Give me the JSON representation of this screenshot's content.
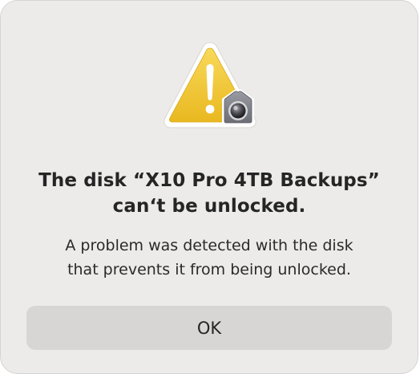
{
  "dialog": {
    "icon": "warning-icon",
    "badge_icon": "lock-icon",
    "title_lines": [
      "The disk “X10 Pro 4TB Backups”",
      "can‘t be unlocked."
    ],
    "message_lines": [
      "A problem was detected with the disk",
      "that prevents it from being unlocked."
    ],
    "ok_label": "OK"
  },
  "colors": {
    "dialog_background": "#ecebea",
    "warning_yellow": "#f2c531",
    "button_background": "#d7d6d5"
  }
}
